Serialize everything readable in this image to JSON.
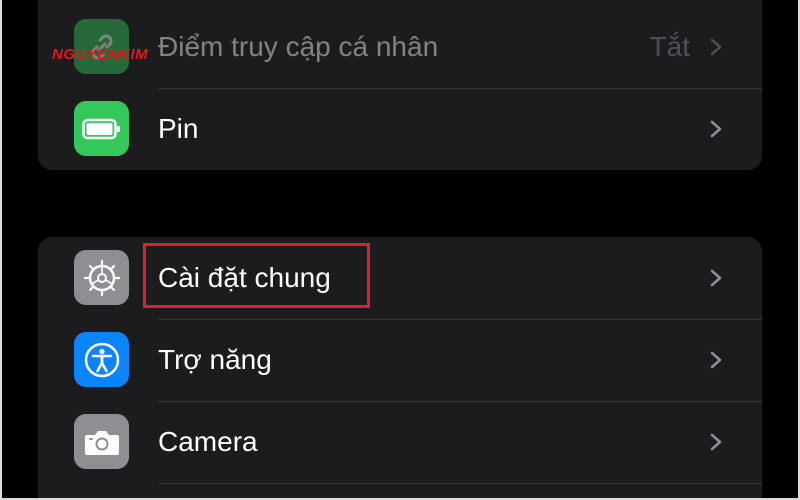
{
  "watermark": "NGUYENKIM",
  "group_top": {
    "rows": [
      {
        "label": "Điểm truy cập cá nhân",
        "value": "Tắt",
        "icon": "chain-link-icon",
        "icon_color": "#34c759"
      },
      {
        "label": "Pin",
        "value": "",
        "icon": "battery-icon",
        "icon_color": "#34c759"
      }
    ]
  },
  "group_bottom": {
    "rows": [
      {
        "label": "Cài đặt chung",
        "icon": "gear-icon",
        "icon_color": "#8e8e93",
        "highlighted": true
      },
      {
        "label": "Trợ năng",
        "icon": "accessibility-icon",
        "icon_color": "#0a84ff"
      },
      {
        "label": "Camera",
        "icon": "camera-icon",
        "icon_color": "#8e8e93"
      }
    ]
  },
  "colors": {
    "highlight": "#d9232e",
    "background": "#000000",
    "cell": "#1c1c1e"
  }
}
